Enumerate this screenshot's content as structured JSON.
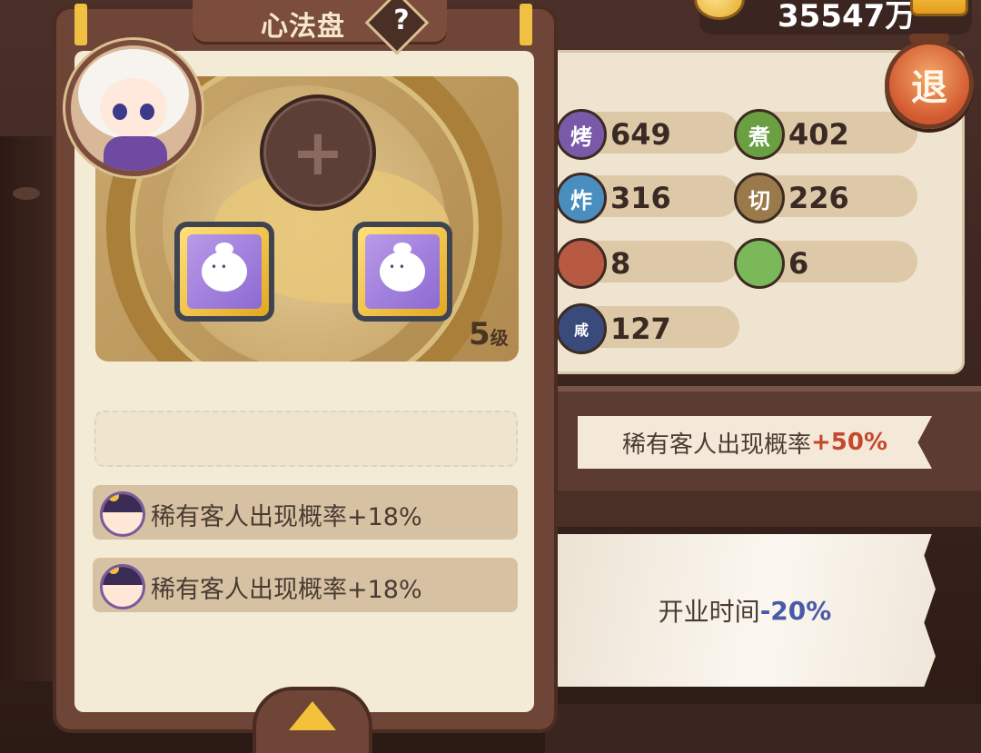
{
  "panel": {
    "title": "心法盘",
    "help_label": "?",
    "level": "5",
    "level_unit": "级",
    "add_symbol": "+"
  },
  "currency": {
    "amount": "35547万"
  },
  "exit_button": {
    "label": "退"
  },
  "stats": [
    {
      "icon": "烤",
      "value": "649",
      "color": "#7a5aa8"
    },
    {
      "icon": "煮",
      "value": "402",
      "color": "#6aa042"
    },
    {
      "icon": "炸",
      "value": "316",
      "color": "#4a8ec0"
    },
    {
      "icon": "切",
      "value": "226",
      "color": "#9a7a4a"
    },
    {
      "icon": "",
      "value": "8",
      "color": "#b85a42"
    },
    {
      "icon": "",
      "value": "6",
      "color": "#7ab85a"
    },
    {
      "icon": "咸",
      "value": "127",
      "color": "#3a4a7a"
    }
  ],
  "buffs": [
    {
      "text": "稀有客人出现概率+18%"
    },
    {
      "text": "稀有客人出现概率+18%"
    }
  ],
  "summary": {
    "rare_label": "稀有客人出现概率",
    "rare_value": "+50%",
    "open_label": "开业时间",
    "open_value": "-20%"
  }
}
